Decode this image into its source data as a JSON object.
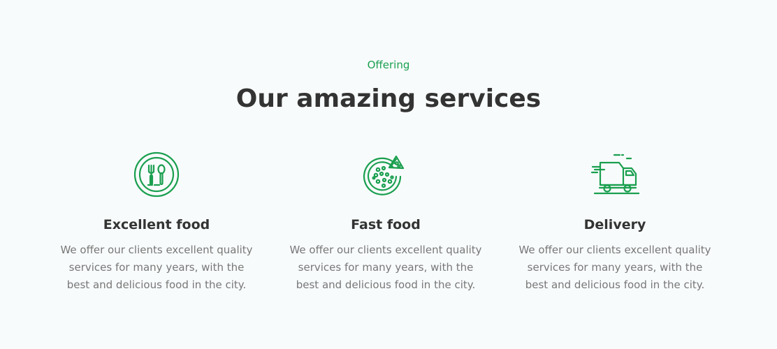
{
  "section": {
    "eyebrow": "Offering",
    "title": "Our amazing services"
  },
  "services": [
    {
      "icon": "fork-spoon-icon",
      "title": "Excellent food",
      "description": "We offer our clients excellent quality services for many years, with the best and delicious food in the city."
    },
    {
      "icon": "pizza-icon",
      "title": "Fast food",
      "description": "We offer our clients excellent quality services for many years, with the best and delicious food in the city."
    },
    {
      "icon": "delivery-truck-icon",
      "title": "Delivery",
      "description": "We offer our clients excellent quality services for many years, with the best and delicious food in the city."
    }
  ],
  "colors": {
    "accent": "#1a9f4f",
    "heading": "#333333",
    "text": "#777777",
    "background": "#f8fbfc"
  }
}
